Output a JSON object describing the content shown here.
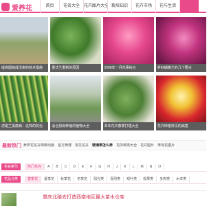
{
  "brand": {
    "logo_glyph": "",
    "name": "爱养花",
    "accent": "#e94b8a"
  },
  "nav": [
    {
      "label": "首页",
      "active": false
    },
    {
      "label": "花名大全",
      "active": false
    },
    {
      "label": "花卉图片大全",
      "active": false
    },
    {
      "label": "栽培知识",
      "active": false
    },
    {
      "label": "花卉市场",
      "active": false
    },
    {
      "label": "花与生活",
      "active": false
    },
    {
      "label": "",
      "active": true
    }
  ],
  "photos_row1": [
    {
      "caption": "提高圆柏成活率的技术措施"
    },
    {
      "caption": "重式兰重新的原因"
    },
    {
      "caption": "2008年一月花事综合"
    },
    {
      "caption": "养好蝴蝶兰的几个要点"
    }
  ],
  "photos_row2": [
    {
      "caption": "虎尾兰黑腐病：这样的防治"
    },
    {
      "caption": "适合厨房种植的植物大全"
    },
    {
      "caption": "本本花卉春季打理大全"
    },
    {
      "caption": "花卉种植常见的病害"
    }
  ],
  "hot": {
    "title": "最新热门",
    "links": [
      "养萝花花卉网移动版",
      "官方微博",
      "常见花卉",
      "玻璃翠怎么养",
      "花的种类大全",
      "花卉图片",
      "苯荷花图片"
    ],
    "emphasis_index": 3
  },
  "categories": [
    {
      "label": "花名索引",
      "items": [
        "热门花卉",
        "A",
        "B",
        "C",
        "D",
        "E",
        "F",
        "G",
        "H",
        "J",
        "K",
        "L",
        "M",
        "N",
        "O"
      ]
    },
    {
      "label": "花品分类",
      "items": [
        "春季花",
        "夏季花",
        "秋季花",
        "冬季花",
        "阳光类",
        "喜阴类",
        "观叶类",
        "观果类",
        "多肉类",
        "木本类"
      ]
    }
  ],
  "feature": {
    "title": "重庆北碚去打造西南地区最大苗木仓库"
  }
}
